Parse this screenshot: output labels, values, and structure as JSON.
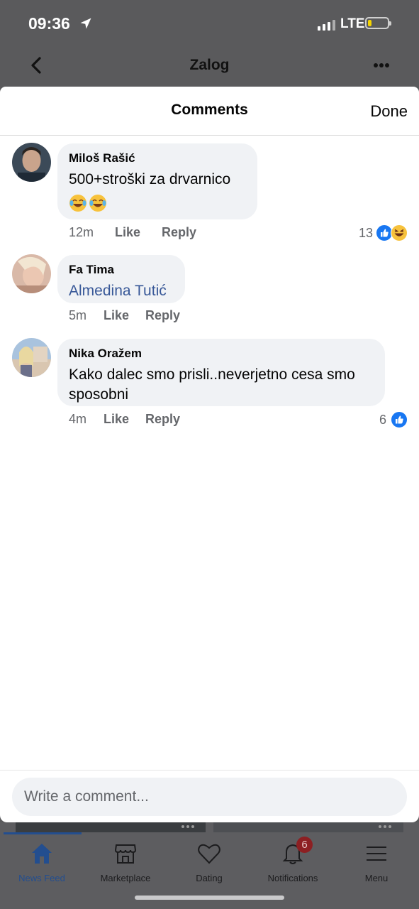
{
  "status_bar": {
    "time": "09:36",
    "network": "LTE",
    "battery_level": 0.2,
    "battery_color": "#f5d400"
  },
  "page": {
    "title": "Zalog"
  },
  "comments_sheet": {
    "title": "Comments",
    "done_label": "Done",
    "comments": [
      {
        "author": "Miloš Rašić",
        "text": "500+stroški za drvarnico",
        "emojis": [
          "face-with-tears-of-joy-icon",
          "face-with-tears-of-joy-icon"
        ],
        "age": "12m",
        "like_label": "Like",
        "reply_label": "Reply",
        "reaction_count": "13",
        "reactions": [
          "like-reaction-icon",
          "haha-reaction-icon"
        ]
      },
      {
        "author": "Fa Tima",
        "text": "Almedina Tutić",
        "is_mention": true,
        "age": "5m",
        "like_label": "Like",
        "reply_label": "Reply"
      },
      {
        "author": "Nika Oražem",
        "text": "Kako dalec smo prisli..neverjetno cesa smo sposobni",
        "age": "4m",
        "like_label": "Like",
        "reply_label": "Reply",
        "reaction_count": "6",
        "reactions": [
          "like-reaction-icon"
        ]
      }
    ],
    "composer": {
      "placeholder": "Write a comment..."
    }
  },
  "tab_bar": {
    "tabs": [
      {
        "label": "News Feed",
        "icon": "home-icon",
        "active": true
      },
      {
        "label": "Marketplace",
        "icon": "storefront-icon"
      },
      {
        "label": "Dating",
        "icon": "heart-icon"
      },
      {
        "label": "Notifications",
        "icon": "bell-icon",
        "badge": "6"
      },
      {
        "label": "Menu",
        "icon": "hamburger-menu-icon"
      }
    ],
    "accent_color": "#234e8f"
  },
  "colors": {
    "link": "#385898",
    "like_blue": "#1877f2",
    "bubble": "#f0f2f5",
    "badge": "#e41e3f"
  }
}
